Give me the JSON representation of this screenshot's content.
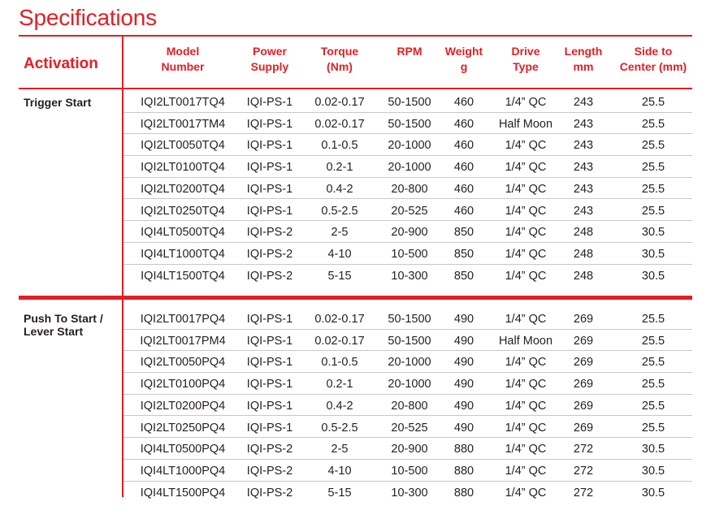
{
  "title": "Specifications",
  "header": {
    "activation": "Activation",
    "columns": [
      {
        "line1": "Model",
        "line2": "Number"
      },
      {
        "line1": "Power",
        "line2": "Supply"
      },
      {
        "line1": "Torque",
        "line2": "(Nm)"
      },
      {
        "line1": "RPM",
        "line2": ""
      },
      {
        "line1": "Weight",
        "line2": "g"
      },
      {
        "line1": "Drive",
        "line2": "Type"
      },
      {
        "line1": "Length",
        "line2": "mm"
      },
      {
        "line1": "Side to",
        "line2": "Center (mm)"
      }
    ]
  },
  "groups": [
    {
      "label_line1": "Trigger Start",
      "label_line2": "",
      "rows": [
        [
          "IQI2LT0017TQ4",
          "IQI-PS-1",
          "0.02-0.17",
          "50-1500",
          "460",
          "1/4” QC",
          "243",
          "25.5"
        ],
        [
          "IQI2LT0017TM4",
          "IQI-PS-1",
          "0.02-0.17",
          "50-1500",
          "460",
          "Half Moon",
          "243",
          "25.5"
        ],
        [
          "IQI2LT0050TQ4",
          "IQI-PS-1",
          "0.1-0.5",
          "20-1000",
          "460",
          "1/4” QC",
          "243",
          "25.5"
        ],
        [
          "IQI2LT0100TQ4",
          "IQI-PS-1",
          "0.2-1",
          "20-1000",
          "460",
          "1/4” QC",
          "243",
          "25.5"
        ],
        [
          "IQI2LT0200TQ4",
          "IQI-PS-1",
          "0.4-2",
          "20-800",
          "460",
          "1/4” QC",
          "243",
          "25.5"
        ],
        [
          "IQI2LT0250TQ4",
          "IQI-PS-1",
          "0.5-2.5",
          "20-525",
          "460",
          "1/4” QC",
          "243",
          "25.5"
        ],
        [
          "IQI4LT0500TQ4",
          "IQI-PS-2",
          "2-5",
          "20-900",
          "850",
          "1/4” QC",
          "248",
          "30.5"
        ],
        [
          "IQI4LT1000TQ4",
          "IQI-PS-2",
          "4-10",
          "10-500",
          "850",
          "1/4” QC",
          "248",
          "30.5"
        ],
        [
          "IQI4LT1500TQ4",
          "IQI-PS-2",
          "5-15",
          "10-300",
          "850",
          "1/4” QC",
          "248",
          "30.5"
        ]
      ]
    },
    {
      "label_line1": "Push To Start /",
      "label_line2": "Lever Start",
      "rows": [
        [
          "IQI2LT0017PQ4",
          "IQI-PS-1",
          "0.02-0.17",
          "50-1500",
          "490",
          "1/4” QC",
          "269",
          "25.5"
        ],
        [
          "IQI2LT0017PM4",
          "IQI-PS-1",
          "0.02-0.17",
          "50-1500",
          "490",
          "Half Moon",
          "269",
          "25.5"
        ],
        [
          "IQI2LT0050PQ4",
          "IQI-PS-1",
          "0.1-0.5",
          "20-1000",
          "490",
          "1/4” QC",
          "269",
          "25.5"
        ],
        [
          "IQI2LT0100PQ4",
          "IQI-PS-1",
          "0.2-1",
          "20-1000",
          "490",
          "1/4” QC",
          "269",
          "25.5"
        ],
        [
          "IQI2LT0200PQ4",
          "IQI-PS-1",
          "0.4-2",
          "20-800",
          "490",
          "1/4” QC",
          "269",
          "25.5"
        ],
        [
          "IQI2LT0250PQ4",
          "IQI-PS-1",
          "0.5-2.5",
          "20-525",
          "490",
          "1/4” QC",
          "269",
          "25.5"
        ],
        [
          "IQI4LT0500PQ4",
          "IQI-PS-2",
          "2-5",
          "20-900",
          "880",
          "1/4” QC",
          "272",
          "30.5"
        ],
        [
          "IQI4LT1000PQ4",
          "IQI-PS-2",
          "4-10",
          "10-500",
          "880",
          "1/4” QC",
          "272",
          "30.5"
        ],
        [
          "IQI4LT1500PQ4",
          "IQI-PS-2",
          "5-15",
          "10-300",
          "880",
          "1/4” QC",
          "272",
          "30.5"
        ]
      ]
    }
  ],
  "colors": {
    "accent": "#e31e24",
    "text": "#231f20",
    "row_divider": "#c8c8c8"
  }
}
